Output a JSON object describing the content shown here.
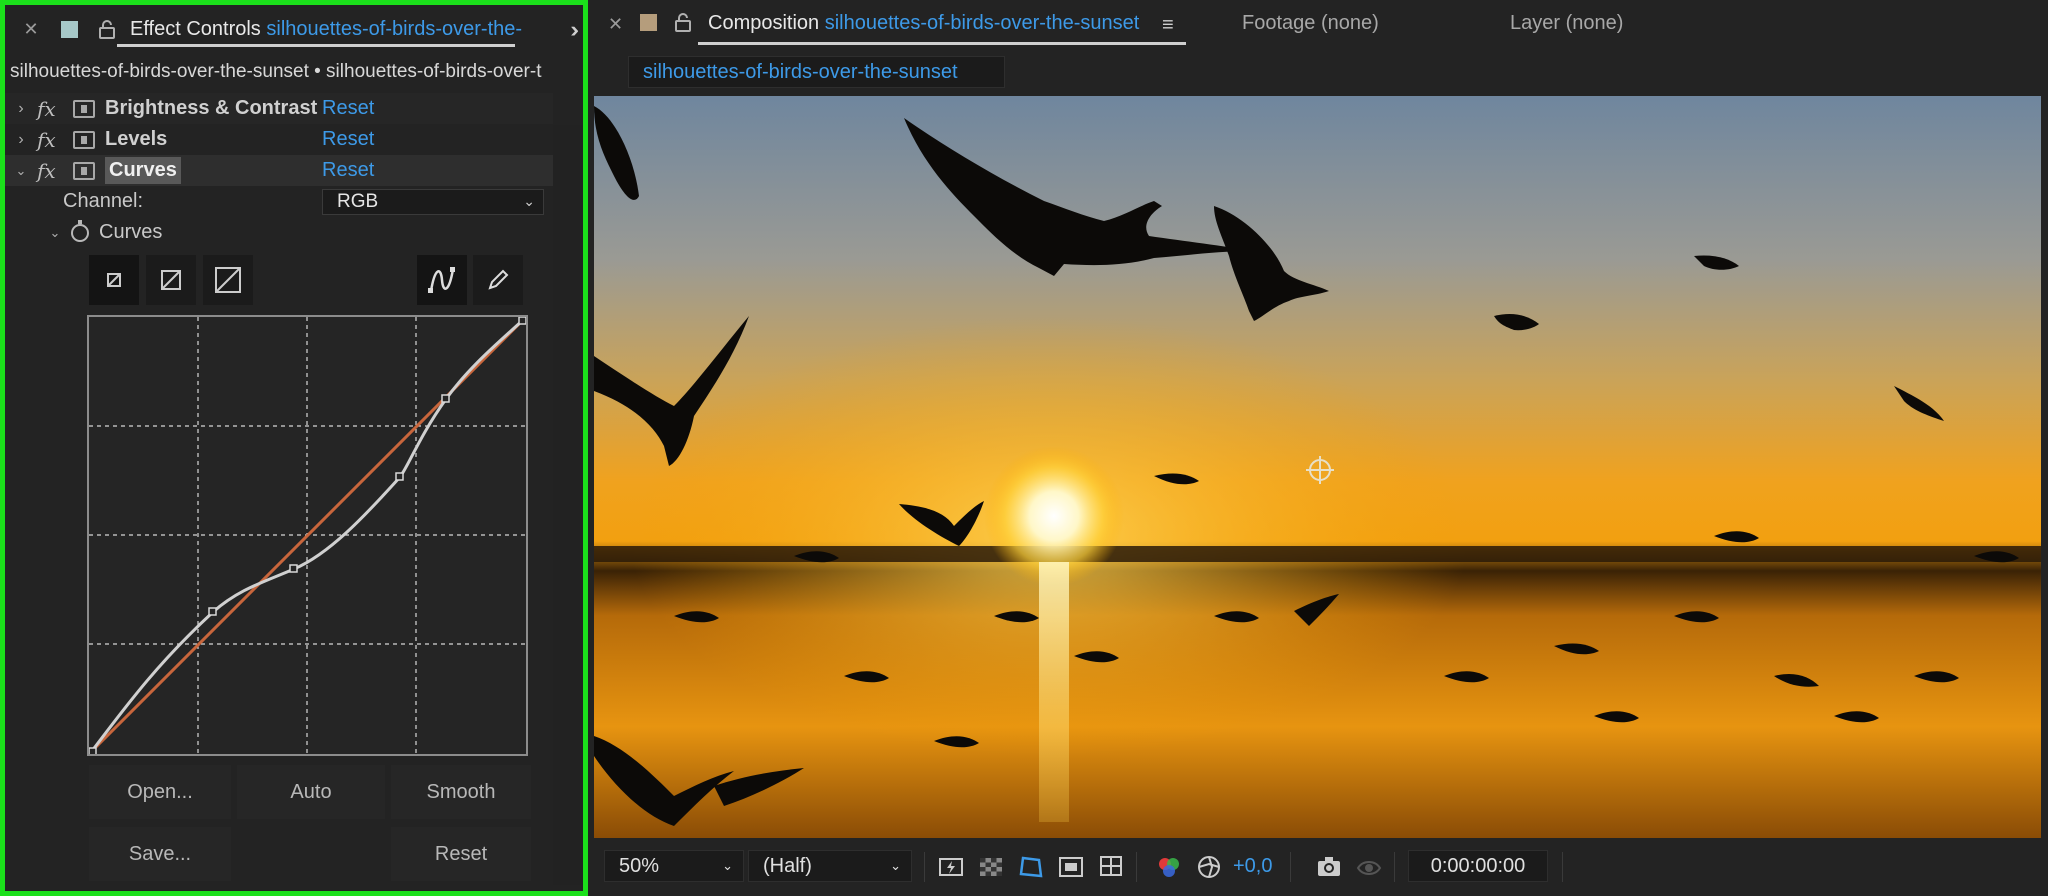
{
  "effect_controls": {
    "tab_label": "Effect Controls",
    "tab_comp_name": "silhouettes-of-birds-over-the-",
    "breadcrumb": "silhouettes-of-birds-over-the-sunset • silhouettes-of-birds-over-t",
    "effects": [
      {
        "name": "Brightness & Contrast",
        "reset": "Reset",
        "expanded": false
      },
      {
        "name": "Levels",
        "reset": "Reset",
        "expanded": false
      },
      {
        "name": "Curves",
        "reset": "Reset",
        "expanded": true
      }
    ],
    "channel_label": "Channel:",
    "channel_value": "RGB",
    "curves_label": "Curves",
    "buttons": {
      "open": "Open...",
      "auto": "Auto",
      "smooth": "Smooth",
      "save": "Save...",
      "reset": "Reset"
    }
  },
  "composition": {
    "tab_label": "Composition",
    "tab_comp_name": "silhouettes-of-birds-over-the-sunset",
    "footage_tab": "Footage (none)",
    "layer_tab": "Layer (none)",
    "sub_tab": "silhouettes-of-birds-over-the-sunset",
    "zoom": "50%",
    "resolution": "(Half)",
    "exposure": "+0,0",
    "timecode": "0:00:00:00"
  },
  "colors": {
    "accent_blue": "#3d9ae8",
    "highlight_green": "#1be01b",
    "curve_orange": "#c8663c"
  }
}
